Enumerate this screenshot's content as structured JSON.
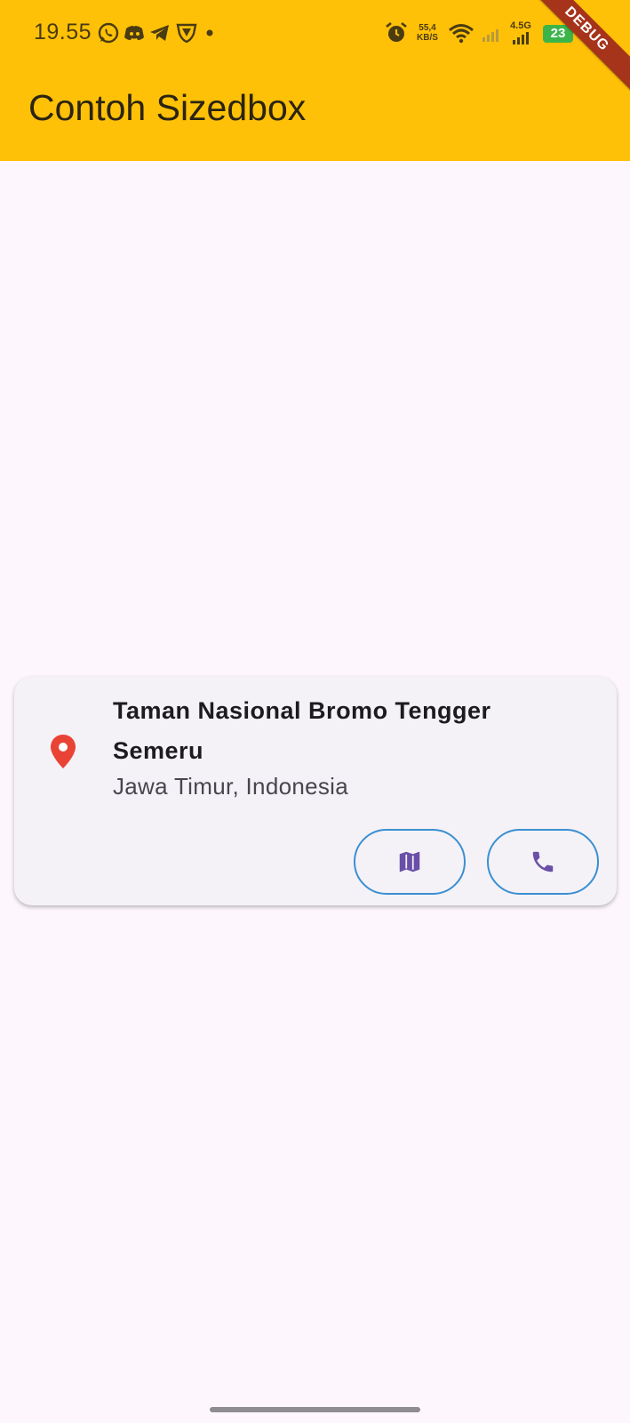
{
  "status_bar": {
    "time": "19.55",
    "net_speed_value": "55,4",
    "net_speed_unit": "KB/S",
    "network_type": "4.5G",
    "battery_level": "23",
    "icons": [
      "whatsapp-icon",
      "discord-icon",
      "telegram-icon",
      "vpn-shield-icon",
      "notification-dot-icon",
      "alarm-icon",
      "wifi-icon",
      "signal-weak-icon",
      "signal-icon",
      "battery-icon"
    ]
  },
  "debug_banner": "DEBUG",
  "app_bar": {
    "title": "Contoh Sizedbox",
    "color": "#ffc107"
  },
  "card": {
    "title": "Taman Nasional Bromo Tengger Semeru",
    "subtitle": "Jawa Timur, Indonesia",
    "leading_icon": "location-pin-icon",
    "leading_icon_color": "#e94335",
    "buttons": [
      {
        "icon": "map-icon",
        "color": "#6a4fa8"
      },
      {
        "icon": "phone-icon",
        "color": "#6a4fa8"
      }
    ]
  }
}
